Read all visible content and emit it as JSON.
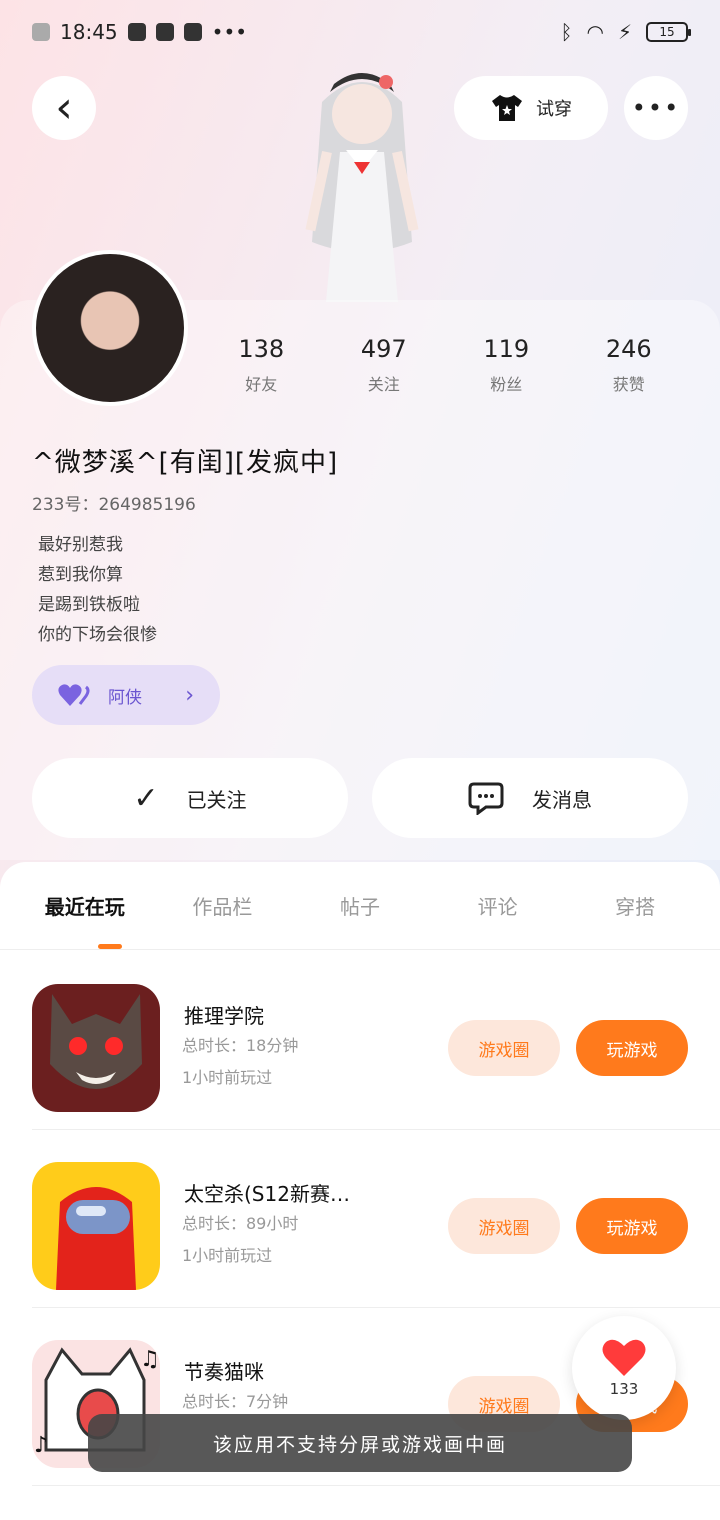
{
  "status_bar": {
    "time": "18:45",
    "battery": "15"
  },
  "header": {
    "try_on_label": "试穿",
    "more_label": "•••",
    "back_label": "‹"
  },
  "stats": [
    {
      "num": "138",
      "label": "好友"
    },
    {
      "num": "497",
      "label": "关注"
    },
    {
      "num": "119",
      "label": "粉丝"
    },
    {
      "num": "246",
      "label": "获赞"
    }
  ],
  "profile": {
    "nickname": "^微梦溪^[有闺][发疯中]",
    "uid": "233号：264985196",
    "bio": [
      "最好别惹我",
      "惹到我你算",
      "是踢到铁板啦",
      "你的下场会很惨"
    ],
    "tag_label": "阿侠"
  },
  "actions": {
    "follow_label": "已关注",
    "message_label": "发消息"
  },
  "tabs": [
    "最近在玩",
    "作品栏",
    "帖子",
    "评论",
    "穿搭"
  ],
  "games": [
    {
      "name": "推理学院",
      "duration": "总时长：18分钟",
      "last_played": "1小时前玩过",
      "circle_label": "游戏圈",
      "play_label": "玩游戏"
    },
    {
      "name": "太空杀(S12新赛…",
      "duration": "总时长：89小时",
      "last_played": "1小时前玩过",
      "circle_label": "游戏圈",
      "play_label": "玩游戏"
    },
    {
      "name": "节奏猫咪",
      "duration": "总时长：7分钟",
      "last_played": "",
      "circle_label": "游戏圈",
      "play_label": "玩游戏"
    }
  ],
  "like": {
    "count": "133"
  },
  "toast": "该应用不支持分屏或游戏画中画",
  "colors": {
    "accent": "#ff7a1c",
    "tag_bg": "#e6def7",
    "tag_fg": "#6a55d0"
  }
}
